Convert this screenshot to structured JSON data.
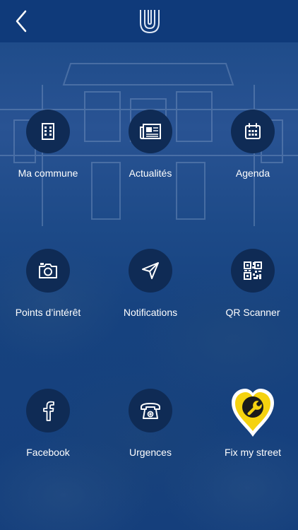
{
  "header": {
    "back_icon": "chevron-left-icon",
    "logo": "u-logo"
  },
  "colors": {
    "topbar": "#0f3a7a",
    "background": "#123d7c",
    "circle": "#0f2b55",
    "label": "#ffffff",
    "fix_my_street_yellow": "#f5d20f"
  },
  "menu": {
    "items": [
      {
        "label": "Ma commune",
        "icon": "building-icon"
      },
      {
        "label": "Actualités",
        "icon": "newspaper-icon"
      },
      {
        "label": "Agenda",
        "icon": "calendar-icon"
      },
      {
        "label": "Points d’intérêt",
        "icon": "camera-icon"
      },
      {
        "label": "Notifications",
        "icon": "paper-plane-icon"
      },
      {
        "label": "QR Scanner",
        "icon": "qr-code-icon"
      },
      {
        "label": "Facebook",
        "icon": "facebook-icon"
      },
      {
        "label": "Urgences",
        "icon": "phone-icon"
      },
      {
        "label": "Fix my street",
        "icon": "wrench-pin-icon"
      }
    ]
  }
}
